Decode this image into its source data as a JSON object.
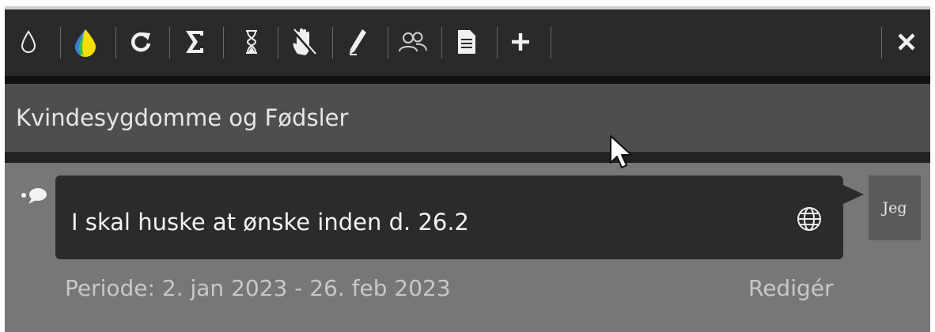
{
  "toolbar": {
    "buttons": [
      {
        "icon": "drop-icon"
      },
      {
        "icon": "color-drop-icon"
      },
      {
        "icon": "refresh-icon"
      },
      {
        "icon": "sigma-icon"
      },
      {
        "icon": "hourglass-icon"
      },
      {
        "icon": "hand-icon"
      },
      {
        "icon": "pencil-icon"
      },
      {
        "icon": "users-icon"
      },
      {
        "icon": "document-icon"
      },
      {
        "icon": "plus-icon"
      }
    ],
    "close_icon": "close-icon"
  },
  "header": {
    "title": "Kvindesygdomme og Fødsler"
  },
  "note": {
    "message": "I skal huske at ønske inden d. 26.2",
    "author": "Jeg",
    "period": "Periode: 2. jan 2023 - 26. feb 2023",
    "edit_label": "Redigér"
  },
  "colors": {
    "toolbar_bg": "#2a2a2a",
    "title_bg": "#4e4e4e",
    "content_bg": "#777777",
    "bubble_bg": "#2b2b2b"
  }
}
